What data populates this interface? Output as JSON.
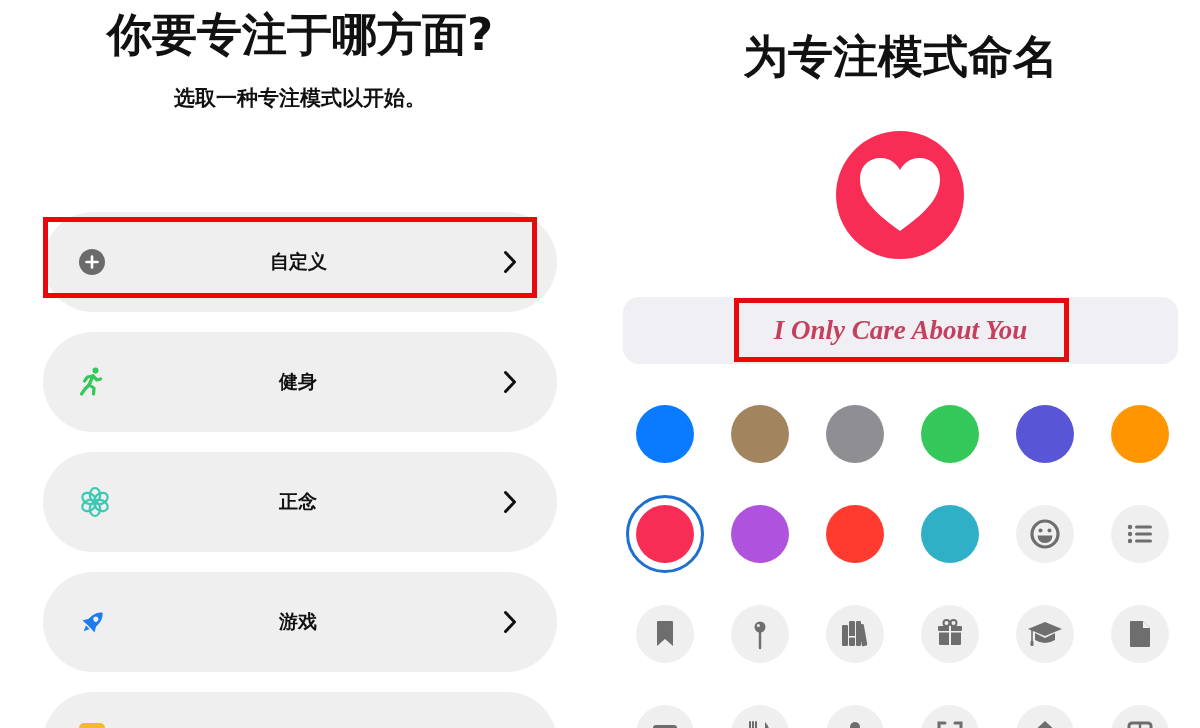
{
  "focus_picker": {
    "title": "你要专注于哪方面?",
    "subtitle": "选取一种专注模式以开始。",
    "items": [
      {
        "label": "自定义",
        "highlighted": true
      },
      {
        "label": "健身",
        "highlighted": false
      },
      {
        "label": "正念",
        "highlighted": false
      },
      {
        "label": "游戏",
        "highlighted": false
      },
      {
        "highlighted": false
      }
    ]
  },
  "name_focus": {
    "title": "为专注模式命名",
    "name_field": {
      "value": "I Only Care About You",
      "highlighted": true
    },
    "options": [
      {
        "kind": "color",
        "color": "#0a7aff",
        "selected": false
      },
      {
        "kind": "color",
        "color": "#a2845e",
        "selected": false
      },
      {
        "kind": "color",
        "color": "#8e8e93",
        "selected": false
      },
      {
        "kind": "color",
        "color": "#34c759",
        "selected": false
      },
      {
        "kind": "color",
        "color": "#5856d6",
        "selected": false
      },
      {
        "kind": "color",
        "color": "#ff9500",
        "selected": false
      },
      {
        "kind": "color",
        "color": "#f72d55",
        "selected": true
      },
      {
        "kind": "color",
        "color": "#af52de",
        "selected": false
      },
      {
        "kind": "color",
        "color": "#ff3b30",
        "selected": false
      },
      {
        "kind": "color",
        "color": "#30b0c7",
        "selected": false
      },
      {
        "kind": "symbol",
        "selected": false
      },
      {
        "kind": "symbol",
        "selected": false
      },
      {
        "kind": "symbol",
        "selected": false
      },
      {
        "kind": "symbol",
        "selected": false
      },
      {
        "kind": "symbol",
        "selected": false
      },
      {
        "kind": "symbol",
        "selected": false
      },
      {
        "kind": "symbol",
        "selected": false
      },
      {
        "kind": "symbol",
        "selected": false
      },
      {
        "kind": "symbol",
        "selected": false
      },
      {
        "kind": "symbol",
        "selected": false
      },
      {
        "kind": "symbol",
        "selected": false
      },
      {
        "kind": "symbol",
        "selected": false
      },
      {
        "kind": "symbol",
        "selected": false
      },
      {
        "kind": "symbol",
        "selected": false
      }
    ]
  }
}
